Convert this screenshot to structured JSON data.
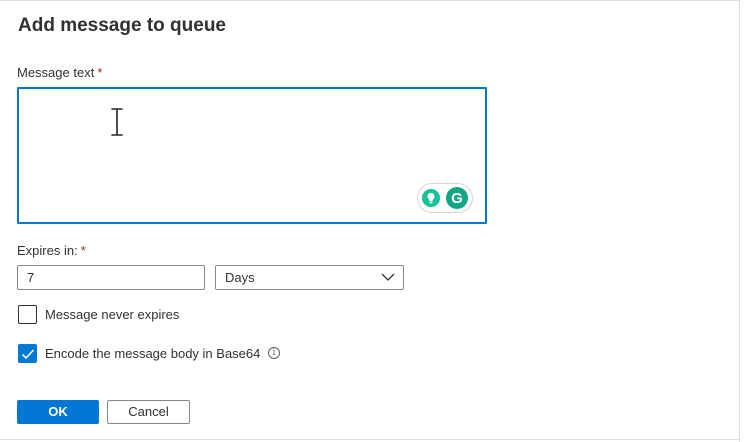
{
  "dialog": {
    "title": "Add message to queue"
  },
  "message_text": {
    "label": "Message text",
    "required_mark": "*",
    "value": ""
  },
  "grammarly": {
    "logo_letter": "G",
    "bulb_icon": "lightbulb-icon",
    "logo_icon": "grammarly-icon"
  },
  "expires": {
    "label": "Expires in:",
    "required_mark": "*",
    "value": "7",
    "unit_selected": "Days"
  },
  "never_expires": {
    "label": "Message never expires",
    "checked": false
  },
  "encode_base64": {
    "label": "Encode the message body in Base64",
    "checked": true,
    "info_glyph": "i"
  },
  "buttons": {
    "ok_label": "OK",
    "cancel_label": "Cancel"
  },
  "colors": {
    "accent": "#0078d4",
    "required": "#a4262c",
    "grammarly_green": "#15c39a"
  }
}
